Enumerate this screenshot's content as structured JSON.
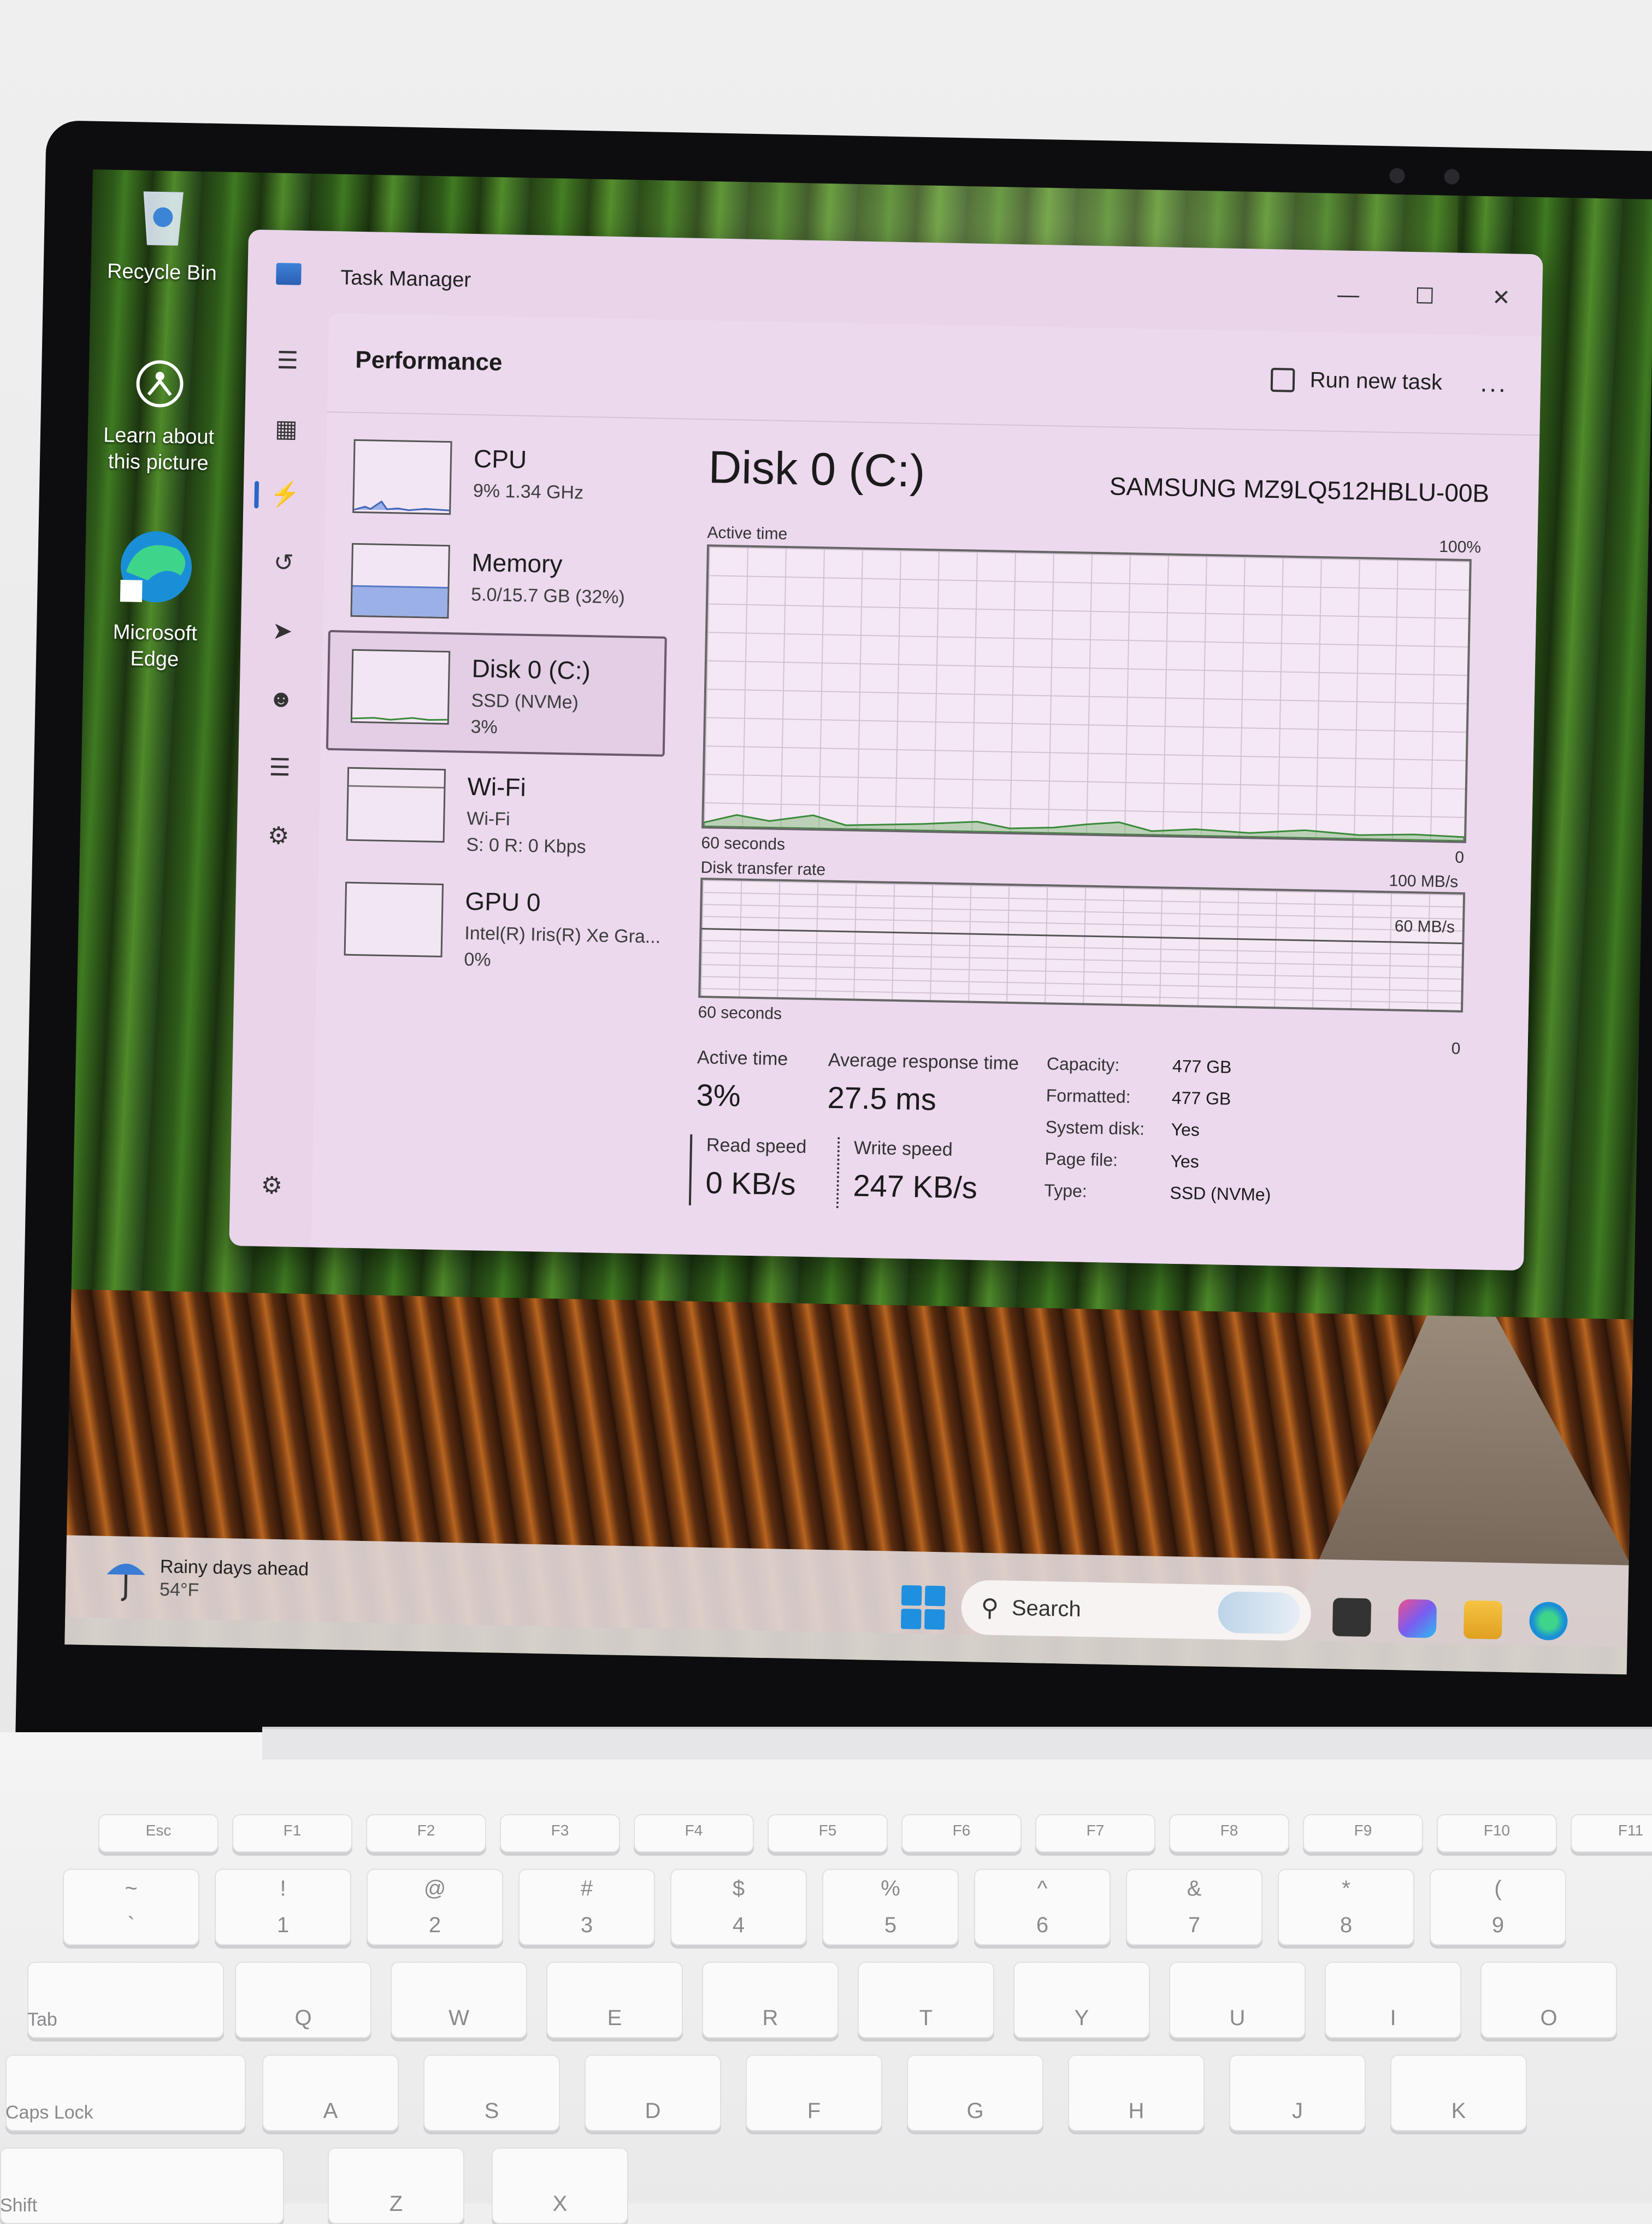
{
  "desktop": {
    "icons": [
      {
        "label": "Recycle Bin",
        "icon": "recycle-bin-icon"
      },
      {
        "label_line1": "Learn about",
        "label_line2": "this picture",
        "icon": "spotlight-camera-icon"
      },
      {
        "label_line1": "Microsoft",
        "label_line2": "Edge",
        "icon": "edge-icon"
      }
    ]
  },
  "taskbar": {
    "weather_title": "Rainy days ahead",
    "weather_temp": "54°F",
    "search_label": "Search"
  },
  "task_manager": {
    "title": "Task Manager",
    "page_title": "Performance",
    "run_new_task": "Run new task",
    "more": "...",
    "devices": [
      {
        "name": "CPU",
        "sub1": "9% 1.34 GHz"
      },
      {
        "name": "Memory",
        "sub1": "5.0/15.7 GB (32%)"
      },
      {
        "name": "Disk 0 (C:)",
        "sub1": "SSD (NVMe)",
        "sub2": "3%",
        "selected": true
      },
      {
        "name": "Wi-Fi",
        "sub1": "Wi-Fi",
        "sub2": "S: 0 R: 0 Kbps"
      },
      {
        "name": "GPU 0",
        "sub1": "Intel(R) Iris(R) Xe Gra...",
        "sub2": "0%"
      }
    ],
    "detail": {
      "title": "Disk 0 (C:)",
      "model": "SAMSUNG MZ9LQ512HBLU-00B",
      "graph1_label": "Active time",
      "graph1_max": "100%",
      "graph1_time": "60 seconds",
      "graph1_min": "0",
      "graph2_label": "Disk transfer rate",
      "graph2_max": "100 MB/s",
      "graph2_mid": "60 MB/s",
      "graph2_time": "60 seconds",
      "graph2_min": "0",
      "active_time_label": "Active time",
      "active_time_value": "3%",
      "avg_response_label": "Average response time",
      "avg_response_value": "27.5 ms",
      "read_speed_label": "Read speed",
      "read_speed_value": "0 KB/s",
      "write_speed_label": "Write speed",
      "write_speed_value": "247 KB/s",
      "props": [
        {
          "key": "Capacity:",
          "value": "477 GB"
        },
        {
          "key": "Formatted:",
          "value": "477 GB"
        },
        {
          "key": "System disk:",
          "value": "Yes"
        },
        {
          "key": "Page file:",
          "value": "Yes"
        },
        {
          "key": "Type:",
          "value": "SSD (NVMe)"
        }
      ]
    }
  },
  "keyboard": {
    "row_fn": [
      "Esc",
      "F1",
      "F2",
      "F3",
      "F4",
      "F5",
      "F6",
      "F7",
      "F8",
      "F9",
      "F10",
      "F11"
    ],
    "row_num_top": [
      "~",
      "!",
      "@",
      "#",
      "$",
      "%",
      "^",
      "&",
      "*",
      "("
    ],
    "row_num_bot": [
      "`",
      "1",
      "2",
      "3",
      "4",
      "5",
      "6",
      "7",
      "8",
      "9"
    ],
    "row_q": [
      "Tab",
      "Q",
      "W",
      "E",
      "R",
      "T",
      "Y",
      "U",
      "I",
      "O"
    ],
    "row_a": [
      "Caps Lock",
      "A",
      "S",
      "D",
      "F",
      "G",
      "H",
      "J",
      "K"
    ],
    "row_z": [
      "Shift",
      "Z",
      "X"
    ]
  },
  "colors": {
    "accent": "#2b66c9",
    "window_bg": "#e9d4ea",
    "memory_fill": "#9ab0e6"
  }
}
